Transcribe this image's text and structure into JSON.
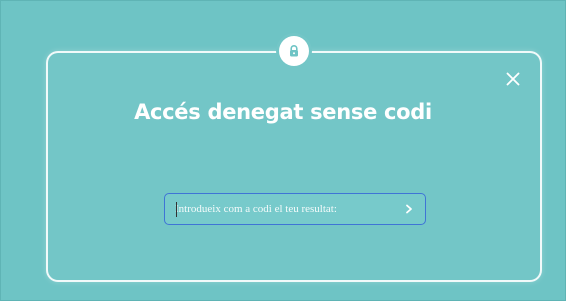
{
  "modal": {
    "title": "Accés denegat sense codi",
    "input": {
      "placeholder": "Introdueix com a codi el teu resultat:",
      "value": ""
    },
    "icons": {
      "lock": "lock-icon",
      "close": "close-icon",
      "submit": "chevron-right-icon"
    }
  },
  "colors": {
    "background": "#6ec4c5",
    "modal_border": "#ffffff",
    "input_border": "#3f74d6",
    "text": "#ffffff"
  }
}
